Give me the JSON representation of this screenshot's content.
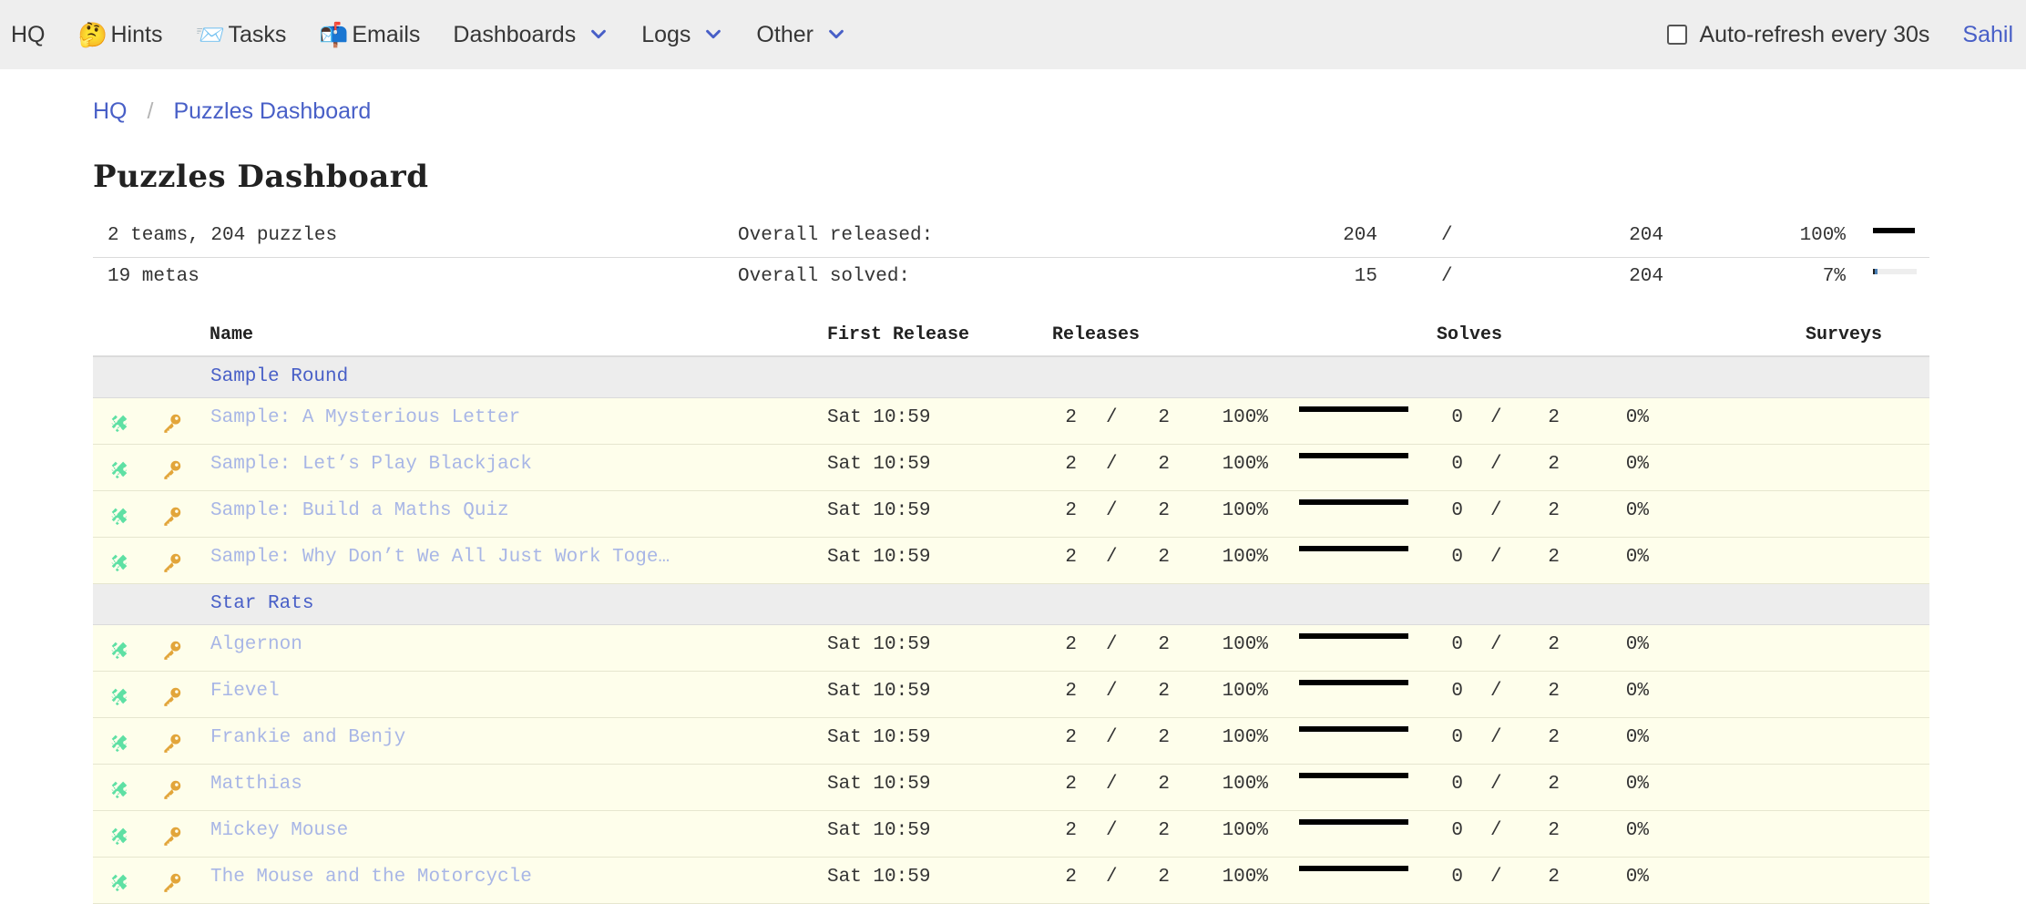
{
  "nav": {
    "home": "HQ",
    "items": [
      {
        "label": "Hints",
        "icon": "🤔",
        "icon_name": "thinking-face-icon"
      },
      {
        "label": "Tasks",
        "icon": "📨",
        "icon_name": "incoming-envelope-icon"
      },
      {
        "label": "Emails",
        "icon": "📬",
        "icon_name": "mailbox-icon"
      },
      {
        "label": "Dashboards",
        "dropdown": true
      },
      {
        "label": "Logs",
        "dropdown": true
      },
      {
        "label": "Other",
        "dropdown": true
      }
    ],
    "autorefresh_label": "Auto-refresh every 30s",
    "autorefresh_checked": false,
    "user": "Sahil"
  },
  "breadcrumb": [
    "HQ",
    "Puzzles Dashboard"
  ],
  "breadcrumb_separator": "/",
  "title": "Puzzles Dashboard",
  "summary": [
    {
      "left": "2 teams, 204 puzzles",
      "label": "Overall released:",
      "num": "204",
      "slash": "/",
      "den": "204",
      "pct": "100%",
      "fraction": 1.0,
      "bar_color": "#000000"
    },
    {
      "left": "19 metas",
      "label": "Overall solved:",
      "num": "15",
      "slash": "/",
      "den": "204",
      "pct": "7%",
      "fraction": 0.07,
      "bar_color": "#4a7fb5"
    }
  ],
  "columns": {
    "name": "Name",
    "first_release": "First Release",
    "releases": "Releases",
    "solves": "Solves",
    "surveys": "Surveys"
  },
  "rounds": [
    {
      "name": "Sample Round",
      "puzzles": [
        {
          "name": "Sample: A Mysterious Letter",
          "first_release": "Sat 10:59",
          "rel": "2",
          "rel_total": "2",
          "rel_pct": "100%",
          "rel_fraction": 1.0,
          "sol": "0",
          "sol_total": "2",
          "sol_pct": "0%"
        },
        {
          "name": "Sample: Let’s Play Blackjack",
          "first_release": "Sat 10:59",
          "rel": "2",
          "rel_total": "2",
          "rel_pct": "100%",
          "rel_fraction": 1.0,
          "sol": "0",
          "sol_total": "2",
          "sol_pct": "0%"
        },
        {
          "name": "Sample: Build a Maths Quiz",
          "first_release": "Sat 10:59",
          "rel": "2",
          "rel_total": "2",
          "rel_pct": "100%",
          "rel_fraction": 1.0,
          "sol": "0",
          "sol_total": "2",
          "sol_pct": "0%"
        },
        {
          "name": "Sample: Why Don’t We All Just Work Toge…",
          "first_release": "Sat 10:59",
          "rel": "2",
          "rel_total": "2",
          "rel_pct": "100%",
          "rel_fraction": 1.0,
          "sol": "0",
          "sol_total": "2",
          "sol_pct": "0%"
        }
      ]
    },
    {
      "name": "Star Rats",
      "puzzles": [
        {
          "name": "Algernon",
          "first_release": "Sat 10:59",
          "rel": "2",
          "rel_total": "2",
          "rel_pct": "100%",
          "rel_fraction": 1.0,
          "sol": "0",
          "sol_total": "2",
          "sol_pct": "0%"
        },
        {
          "name": "Fievel",
          "first_release": "Sat 10:59",
          "rel": "2",
          "rel_total": "2",
          "rel_pct": "100%",
          "rel_fraction": 1.0,
          "sol": "0",
          "sol_total": "2",
          "sol_pct": "0%"
        },
        {
          "name": "Frankie and Benjy",
          "first_release": "Sat 10:59",
          "rel": "2",
          "rel_total": "2",
          "rel_pct": "100%",
          "rel_fraction": 1.0,
          "sol": "0",
          "sol_total": "2",
          "sol_pct": "0%"
        },
        {
          "name": "Matthias",
          "first_release": "Sat 10:59",
          "rel": "2",
          "rel_total": "2",
          "rel_pct": "100%",
          "rel_fraction": 1.0,
          "sol": "0",
          "sol_total": "2",
          "sol_pct": "0%"
        },
        {
          "name": "Mickey Mouse",
          "first_release": "Sat 10:59",
          "rel": "2",
          "rel_total": "2",
          "rel_pct": "100%",
          "rel_fraction": 1.0,
          "sol": "0",
          "sol_total": "2",
          "sol_pct": "0%"
        },
        {
          "name": "The Mouse and the Motorcycle",
          "first_release": "Sat 10:59",
          "rel": "2",
          "rel_total": "2",
          "rel_pct": "100%",
          "rel_fraction": 1.0,
          "sol": "0",
          "sol_total": "2",
          "sol_pct": "0%"
        }
      ]
    }
  ],
  "colors": {
    "link": "#485fc7",
    "puzzle_link": "#a8b6e6",
    "puzzle_icon": "#5ee0a4",
    "key_icon": "#e2a53a",
    "row_bg": "#fefeeb",
    "round_bg": "#ededed"
  }
}
